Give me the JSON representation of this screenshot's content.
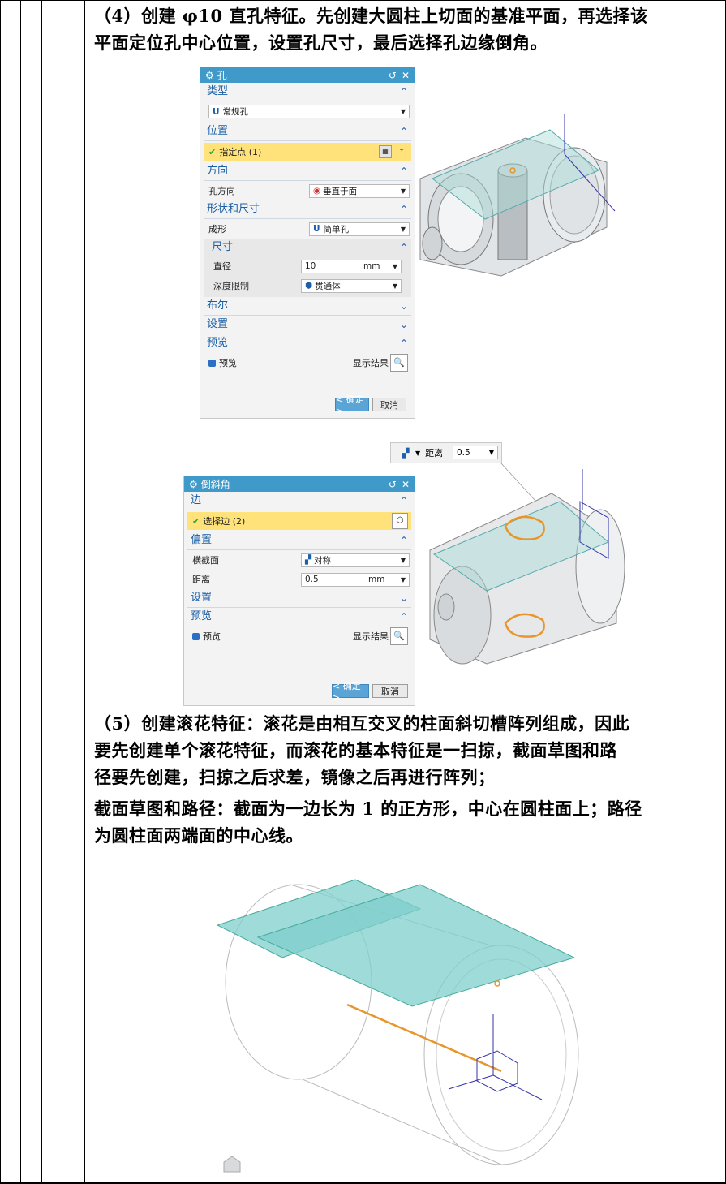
{
  "step4": {
    "text_line1": "（4）创建 φ10 直孔特征。先创建大圆柱上切面的基准平面，再选择该",
    "text_line2": "平面定位孔中心位置，设置孔尺寸，最后选择孔边缘倒角。"
  },
  "hole_dialog": {
    "title": "孔",
    "sections": {
      "type": "类型",
      "type_value": "常规孔",
      "position": "位置",
      "position_item": "指定点 (1)",
      "direction": "方向",
      "direction_label": "孔方向",
      "direction_value": "垂直于面",
      "shape": "形状和尺寸",
      "form_label": "成形",
      "form_value": "简单孔",
      "size": "尺寸",
      "diameter_label": "直径",
      "diameter_value": "10",
      "diameter_unit": "mm",
      "depth_label": "深度限制",
      "depth_value": "贯通体",
      "boolean": "布尔",
      "settings": "设置",
      "preview": "预览",
      "preview_check": "预览",
      "show_result": "显示结果"
    },
    "ok": "< 确定 >",
    "cancel": "取消"
  },
  "chamfer_toolbar": {
    "label": "距离",
    "value": "0.5"
  },
  "chamfer_dialog": {
    "title": "倒斜角",
    "edge": "边",
    "edge_item": "选择边 (2)",
    "offset": "偏置",
    "cross_label": "横截面",
    "cross_value": "对称",
    "distance_label": "距离",
    "distance_value": "0.5",
    "distance_unit": "mm",
    "settings": "设置",
    "preview": "预览",
    "preview_check": "预览",
    "show_result": "显示结果",
    "ok": "< 确定 >",
    "cancel": "取消"
  },
  "step5": {
    "line1": "（5）创建滚花特征：滚花是由相互交叉的柱面斜切槽阵列组成，因此",
    "line2": "要先创建单个滚花特征，而滚花的基本特征是一扫掠，截面草图和路",
    "line3": "径要先创建，扫掠之后求差，镜像之后再进行阵列；",
    "line4": "截面草图和路径：截面为一边长为 1 的正方形，中心在圆柱面上；路径",
    "line5": "为圆柱面两端面的中心线。"
  },
  "colors": {
    "title_bar": "#3f9ac9",
    "highlight": "#ffe27a",
    "plane": "#7fcfcc",
    "path": "#e8962a"
  }
}
